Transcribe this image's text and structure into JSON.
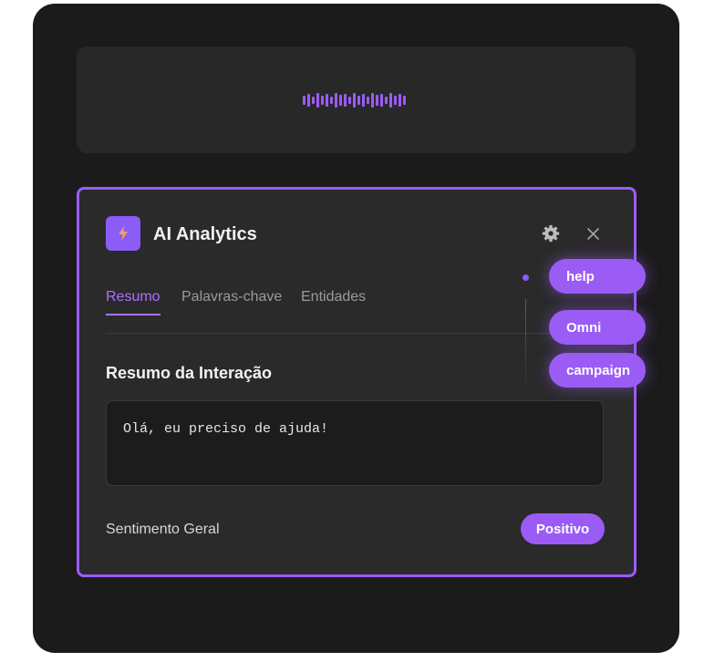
{
  "audio": {
    "waveform_icon": "audio-waveform-icon"
  },
  "widget": {
    "title": "AI Analytics",
    "logo_icon": "lightning-bolt-icon",
    "settings_icon": "gear-icon",
    "close_icon": "close-icon",
    "tabs": [
      {
        "label": "Resumo",
        "active": true
      },
      {
        "label": "Palavras-chave",
        "active": false
      },
      {
        "label": "Entidades",
        "active": false
      }
    ],
    "summary": {
      "heading": "Resumo da Interação",
      "text": "Olá, eu preciso de ajuda!"
    },
    "sentiment": {
      "label": "Sentimento Geral",
      "value": "Positivo"
    }
  },
  "keyword_pills": [
    {
      "label": "help"
    },
    {
      "label": "Omni"
    },
    {
      "label": "campaign"
    }
  ],
  "colors": {
    "accent": "#9b5cf6",
    "accent_text": "#a971ff",
    "background": "#1b1b1b",
    "card": "#2a2a2a",
    "bolt": "#f59e5b"
  }
}
